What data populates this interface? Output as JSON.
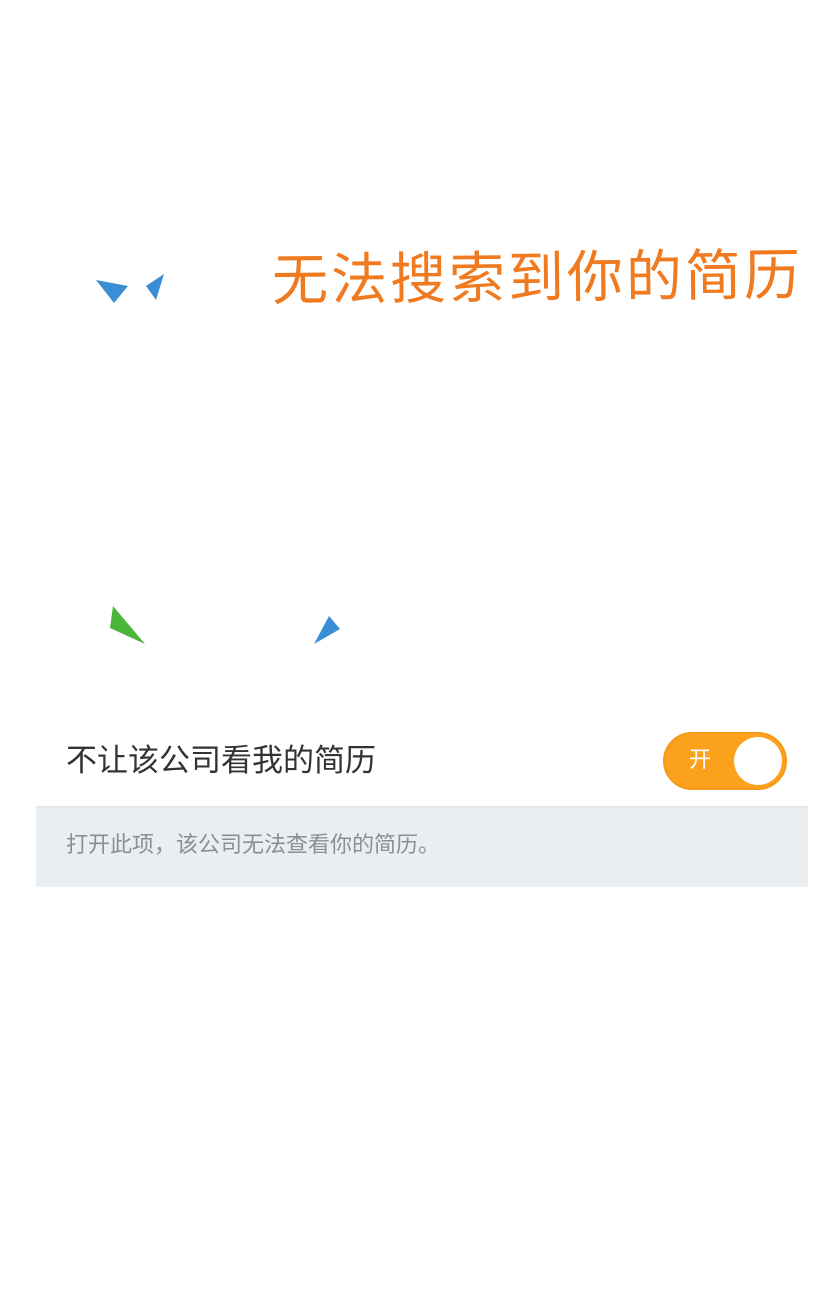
{
  "headline": "无法搜索到你的简历",
  "setting": {
    "label": "不让该公司看我的简历",
    "toggle": {
      "state_label": "开",
      "on": true,
      "color": "#fca11b"
    }
  },
  "hint": "打开此项，该公司无法查看你的简历。",
  "colors": {
    "headline": "#f07a1f",
    "accent_orange": "#fca11b",
    "deco_blue": "#3a8ed6",
    "deco_green": "#4bb53a"
  }
}
